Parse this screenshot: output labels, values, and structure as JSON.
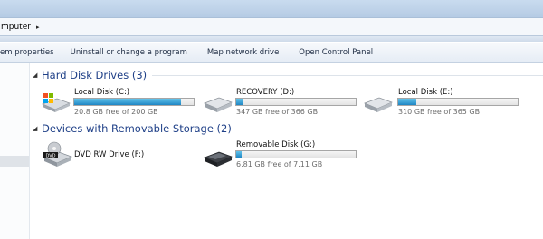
{
  "address": {
    "crumb": "mputer",
    "arrow": "▸"
  },
  "toolbar": {
    "items": [
      "em properties",
      "Uninstall or change a program",
      "Map network drive",
      "Open Control Panel"
    ]
  },
  "groups": {
    "hard_disks": {
      "title": "Hard Disk Drives (3)"
    },
    "removable": {
      "title": "Devices with Removable Storage (2)"
    }
  },
  "drives": [
    {
      "name": "Local Disk (C:)",
      "free": "20.8 GB free of 200 GB",
      "used_fraction": 0.896
    },
    {
      "name": "RECOVERY (D:)",
      "free": "347 GB free of 366 GB",
      "used_fraction": 0.052
    },
    {
      "name": "Local Disk (E:)",
      "free": "310 GB free of 365 GB",
      "used_fraction": 0.151
    },
    {
      "name": "DVD RW Drive (F:)"
    },
    {
      "name": "Removable Disk (G:)",
      "free": "6.81 GB free of 7.11 GB",
      "used_fraction": 0.042
    }
  ],
  "icons": {
    "dvd_badge": "DVD"
  },
  "colors": {
    "group_title": "#1e3f87",
    "bar_fill": "#2a95cf"
  }
}
